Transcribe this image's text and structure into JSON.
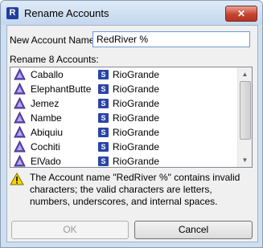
{
  "window": {
    "title": "Rename Accounts",
    "app_icon_glyph": "R",
    "close_glyph": "✕"
  },
  "form": {
    "new_name_label": "New Account Name:",
    "new_name_value": "RedRiver %",
    "rename_label": "Rename 8 Accounts:"
  },
  "accounts": [
    {
      "name": "Caballo",
      "object_badge": "S",
      "object": "RioGrande"
    },
    {
      "name": "ElephantButte",
      "object_badge": "S",
      "object": "RioGrande"
    },
    {
      "name": "Jemez",
      "object_badge": "S",
      "object": "RioGrande"
    },
    {
      "name": "Nambe",
      "object_badge": "S",
      "object": "RioGrande"
    },
    {
      "name": "Abiquiu",
      "object_badge": "S",
      "object": "RioGrande"
    },
    {
      "name": "Cochiti",
      "object_badge": "S",
      "object": "RioGrande"
    },
    {
      "name": "ElVado",
      "object_badge": "S",
      "object": "RioGrande"
    }
  ],
  "warning": {
    "icon": "warning-icon",
    "text": "The Account name \"RedRiver %\" contains invalid characters; the valid characters are letters, numbers, underscores, and internal spaces."
  },
  "buttons": {
    "ok_label": "OK",
    "cancel_label": "Cancel"
  },
  "colors": {
    "account_icon": "#6a4fc0",
    "object_badge": "#2a44a8",
    "close_button": "#c7432f"
  }
}
